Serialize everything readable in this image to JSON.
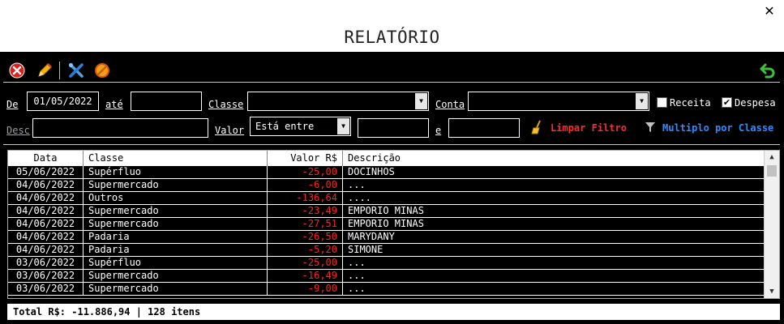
{
  "window": {
    "title": "RELATÓRIO",
    "close_glyph": "✕"
  },
  "toolbar": {
    "buttons": [
      {
        "name": "delete-button",
        "icon": "red-circle-x-icon"
      },
      {
        "name": "edit-button",
        "icon": "pencil-icon"
      },
      {
        "name": "tools-button",
        "icon": "wrench-screwdriver-icon"
      },
      {
        "name": "block-button",
        "icon": "prohibited-icon"
      },
      {
        "name": "back-button",
        "icon": "green-return-arrow-icon"
      }
    ]
  },
  "filters": {
    "de_label": "De",
    "de_value": "01/05/2022",
    "ate_label": "até",
    "ate_value": "",
    "classe_label": "Classe",
    "classe_value": "",
    "conta_label": "Conta",
    "conta_value": "",
    "receita_label": "Receita",
    "receita_checked": false,
    "despesa_label": "Despesa",
    "despesa_checked": true,
    "desc_label": "Desc",
    "desc_value": "",
    "valor_label": "Valor",
    "valor_operator": "Está entre",
    "valor_from": "",
    "e_label": "e",
    "valor_to": "",
    "limpar_label": "Limpar Filtro",
    "multiplo_label": "Multiplo por Classe"
  },
  "table": {
    "columns": [
      "Data",
      "Classe",
      "Valor R$",
      "Descrição"
    ],
    "rows": [
      [
        "05/06/2022",
        "Supérfluo",
        "-25,00",
        "DOCINHOS"
      ],
      [
        "04/06/2022",
        "Supermercado",
        "-6,00",
        "..."
      ],
      [
        "04/06/2022",
        "Outros",
        "-136,64",
        "...."
      ],
      [
        "04/06/2022",
        "Supermercado",
        "-23,49",
        "EMPORIO MINAS"
      ],
      [
        "04/06/2022",
        "Supermercado",
        "-27,51",
        "EMPORIO MINAS"
      ],
      [
        "04/06/2022",
        "Padaria",
        "-26,50",
        "MARYDANY"
      ],
      [
        "04/06/2022",
        "Padaria",
        "-5,20",
        "SIMONE"
      ],
      [
        "03/06/2022",
        "Supérfluo",
        "-25,00",
        "..."
      ],
      [
        "03/06/2022",
        "Supermercado",
        "-16,49",
        "..."
      ],
      [
        "03/06/2022",
        "Supermercado",
        "-9,00",
        "..."
      ]
    ]
  },
  "status": {
    "text": "Total R$: -11.886,94 | 128 itens"
  },
  "colors": {
    "background": "#000000",
    "negative_value": "#ff2020",
    "limpar": "#ff2a2a",
    "multiplo": "#2e8cff"
  }
}
